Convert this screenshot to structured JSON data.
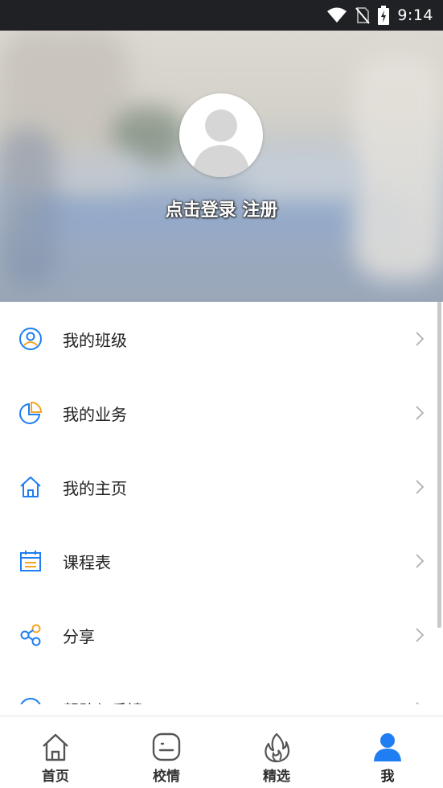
{
  "status_bar": {
    "time": "9:14",
    "icons": [
      "wifi-icon",
      "no-sim-icon",
      "battery-charging-icon"
    ]
  },
  "profile": {
    "login_label": "点击登录",
    "register_label": "注册",
    "avatar_icon": "default-avatar-icon"
  },
  "menu": {
    "items": [
      {
        "label": "我的班级",
        "icon": "user-circle-icon"
      },
      {
        "label": "我的业务",
        "icon": "pie-chart-icon"
      },
      {
        "label": "我的主页",
        "icon": "home-icon"
      },
      {
        "label": "课程表",
        "icon": "calendar-icon"
      },
      {
        "label": "分享",
        "icon": "share-icon"
      },
      {
        "label": "帮助与反馈",
        "icon": "help-icon"
      }
    ]
  },
  "tabbar": {
    "tabs": [
      {
        "label": "首页",
        "icon": "home-outline-icon",
        "active": false
      },
      {
        "label": "校情",
        "icon": "message-outline-icon",
        "active": false
      },
      {
        "label": "精选",
        "icon": "flame-outline-icon",
        "active": false
      },
      {
        "label": "我",
        "icon": "person-filled-icon",
        "active": true
      }
    ]
  },
  "colors": {
    "accent_blue": "#1e7ef2",
    "accent_orange": "#f5a623",
    "status_bar": "#202124"
  }
}
